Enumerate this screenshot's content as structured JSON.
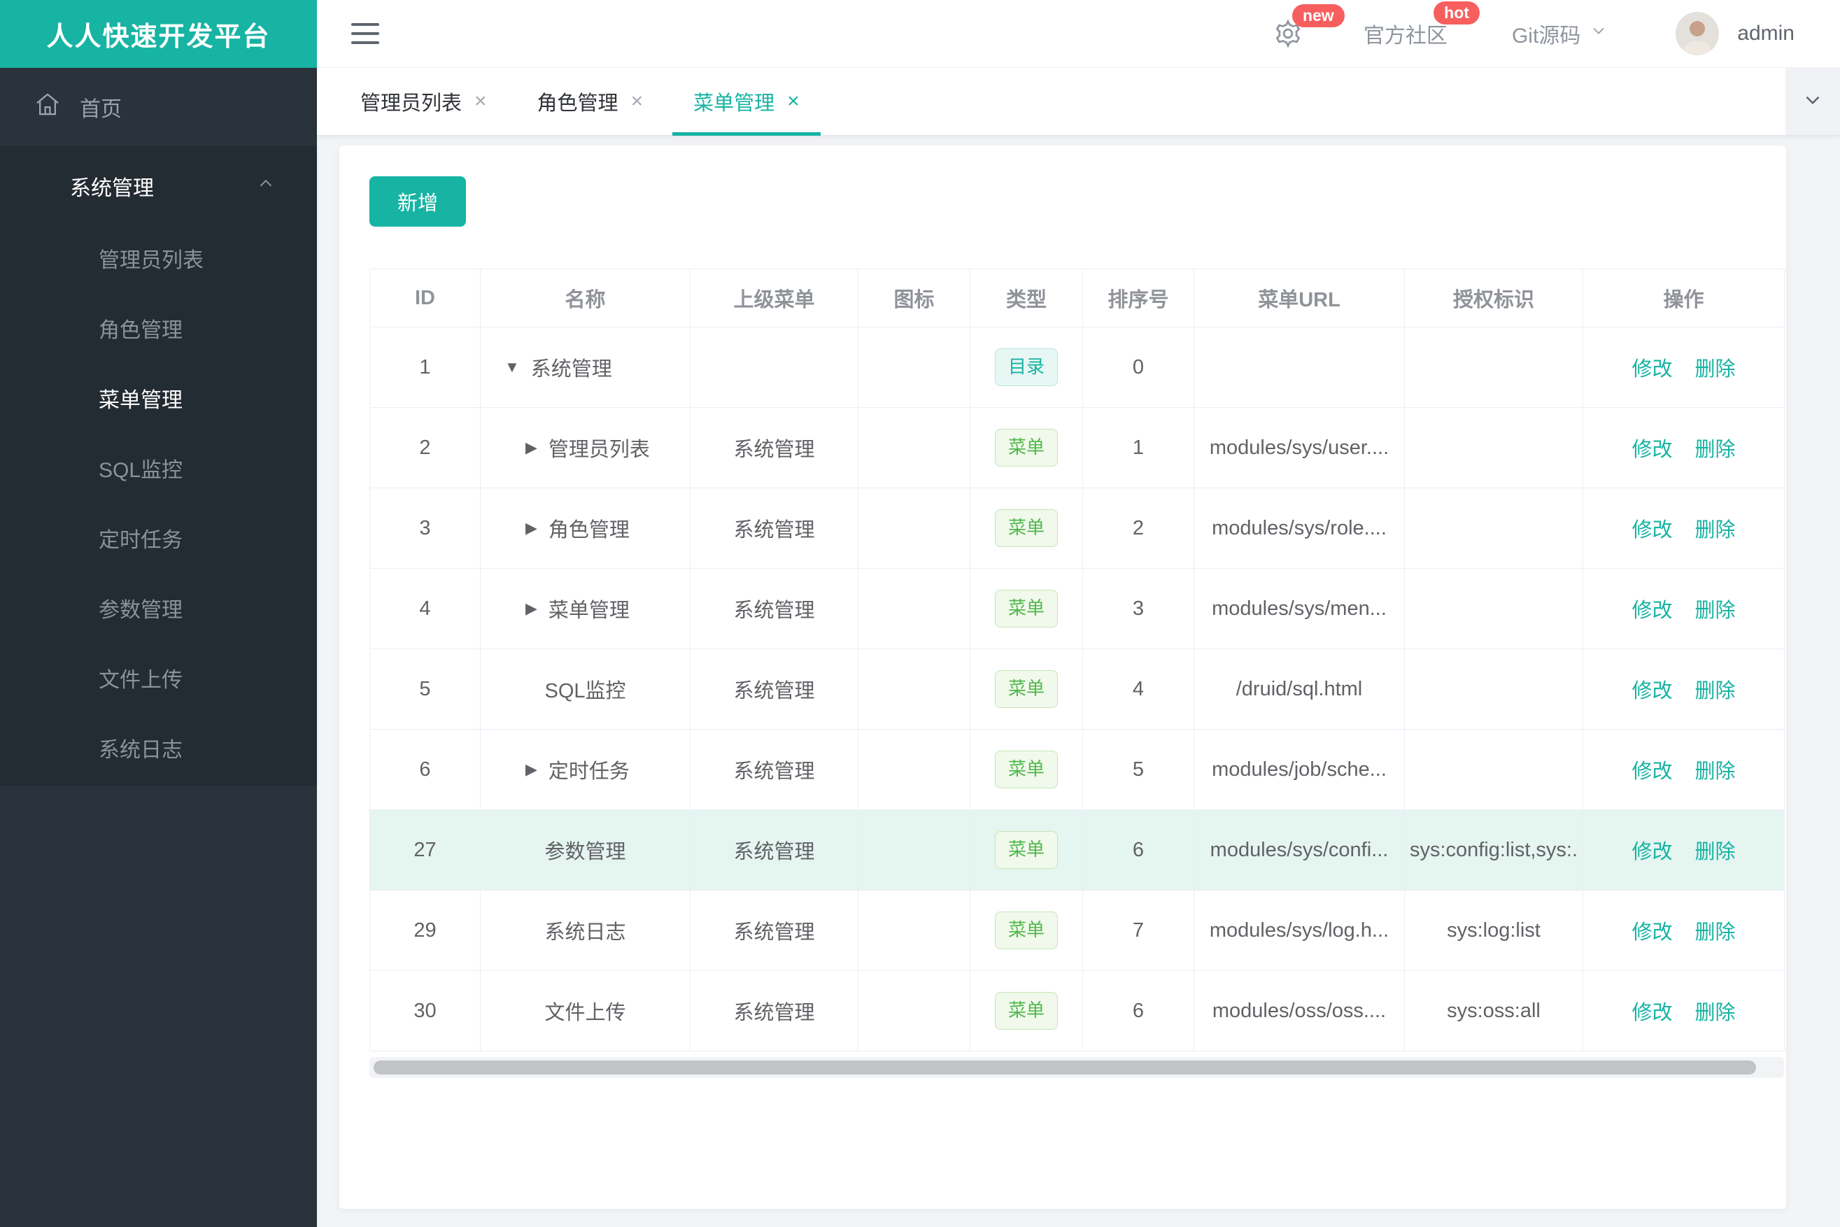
{
  "brand": {
    "title": "人人快速开发平台"
  },
  "colors": {
    "accent": "#17b3a3",
    "badge_red": "#f75e5e",
    "tag_dir_text": "#17b3a3",
    "tag_menu_text": "#52b84c",
    "row_highlight": "#e5f5f0",
    "sidebar_bg": "#2a333c",
    "sidebar_submenu_bg": "#232b33"
  },
  "icons": {
    "close": "×",
    "arrow_down": "▼",
    "arrow_right": "▶"
  },
  "header": {
    "new_badge": "new",
    "community_label": "官方社区",
    "hot_badge": "hot",
    "git_label": "Git源码",
    "user": "admin"
  },
  "sidebar": {
    "home_label": "首页",
    "group": {
      "label": "系统管理",
      "active": "菜单管理",
      "items": [
        "管理员列表",
        "角色管理",
        "菜单管理",
        "SQL监控",
        "定时任务",
        "参数管理",
        "文件上传",
        "系统日志"
      ]
    }
  },
  "tabs": [
    {
      "label": "管理员列表",
      "active": false
    },
    {
      "label": "角色管理",
      "active": false
    },
    {
      "label": "菜单管理",
      "active": true
    }
  ],
  "toolbar": {
    "add_label": "新增"
  },
  "table": {
    "columns": [
      "ID",
      "名称",
      "上级菜单",
      "图标",
      "类型",
      "排序号",
      "菜单URL",
      "授权标识",
      "操作"
    ],
    "type_labels": {
      "dir": "目录",
      "menu": "菜单"
    },
    "actions": {
      "edit": "修改",
      "delete": "删除"
    },
    "rows": [
      {
        "id": "1",
        "name": "系统管理",
        "arrow": "down",
        "level": 0,
        "parent": "",
        "type": "dir",
        "order": "0",
        "url": "",
        "perms": "",
        "highlight": false
      },
      {
        "id": "2",
        "name": "管理员列表",
        "arrow": "right",
        "level": 1,
        "parent": "系统管理",
        "type": "menu",
        "order": "1",
        "url": "modules/sys/user....",
        "perms": "",
        "highlight": false
      },
      {
        "id": "3",
        "name": "角色管理",
        "arrow": "right",
        "level": 1,
        "parent": "系统管理",
        "type": "menu",
        "order": "2",
        "url": "modules/sys/role....",
        "perms": "",
        "highlight": false
      },
      {
        "id": "4",
        "name": "菜单管理",
        "arrow": "right",
        "level": 1,
        "parent": "系统管理",
        "type": "menu",
        "order": "3",
        "url": "modules/sys/men...",
        "perms": "",
        "highlight": false
      },
      {
        "id": "5",
        "name": "SQL监控",
        "arrow": "none",
        "level": 1,
        "parent": "系统管理",
        "type": "menu",
        "order": "4",
        "url": "/druid/sql.html",
        "perms": "",
        "highlight": false
      },
      {
        "id": "6",
        "name": "定时任务",
        "arrow": "right",
        "level": 1,
        "parent": "系统管理",
        "type": "menu",
        "order": "5",
        "url": "modules/job/sche...",
        "perms": "",
        "highlight": false
      },
      {
        "id": "27",
        "name": "参数管理",
        "arrow": "none",
        "level": 1,
        "parent": "系统管理",
        "type": "menu",
        "order": "6",
        "url": "modules/sys/confi...",
        "perms": "sys:config:list,sys:.",
        "highlight": true
      },
      {
        "id": "29",
        "name": "系统日志",
        "arrow": "none",
        "level": 1,
        "parent": "系统管理",
        "type": "menu",
        "order": "7",
        "url": "modules/sys/log.h...",
        "perms": "sys:log:list",
        "highlight": false
      },
      {
        "id": "30",
        "name": "文件上传",
        "arrow": "none",
        "level": 1,
        "parent": "系统管理",
        "type": "menu",
        "order": "6",
        "url": "modules/oss/oss....",
        "perms": "sys:oss:all",
        "highlight": false
      }
    ]
  }
}
